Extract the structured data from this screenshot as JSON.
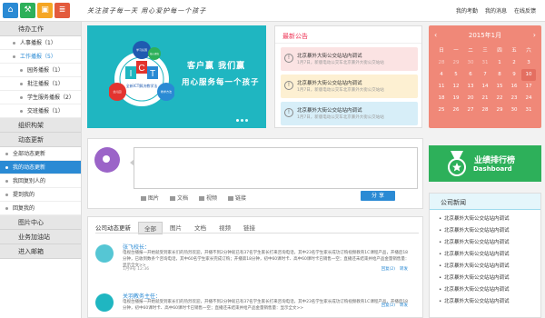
{
  "header": {
    "slogan": "关注孩子每一天   用心爱护每一个孩子",
    "links": [
      "我的考勤",
      "我的消息",
      "在线反馈"
    ],
    "icon_colors": [
      "#2a8ad4",
      "#2db05a",
      "#f5a623",
      "#e35a3c"
    ],
    "icon_names": [
      "home-icon",
      "apps-icon",
      "briefcase-icon",
      "contacts-icon"
    ]
  },
  "sidebar": {
    "sections": [
      {
        "label": "待办工作",
        "items": [
          {
            "label": "人事播报（1）",
            "level": 1
          },
          {
            "label": "工作播报（5）",
            "level": 1,
            "active": true
          },
          {
            "label": "园务播报（1）",
            "level": 2
          },
          {
            "label": "批注播报（1）",
            "level": 2
          },
          {
            "label": "学生服务播报（2）",
            "level": 2
          },
          {
            "label": "交班播报（1）",
            "level": 2
          }
        ]
      },
      {
        "label": "组织构架",
        "items": []
      },
      {
        "label": "动态更新",
        "items": [
          {
            "label": "全部动态更新",
            "level": 1
          },
          {
            "label": "我的动态更新",
            "level": 1,
            "selected": true
          },
          {
            "label": "我回复别人的",
            "level": 1
          },
          {
            "label": "提到我的",
            "level": 1
          },
          {
            "label": "回复我的",
            "level": 1
          }
        ]
      },
      {
        "label": "图片中心",
        "items": []
      },
      {
        "label": "业务加油站",
        "items": []
      },
      {
        "label": "进入邮箱",
        "items": []
      }
    ]
  },
  "banner": {
    "line1": "客户赢   我们赢",
    "line2": "用心服务每一个孩子",
    "logo_letters": [
      "I",
      "C",
      "T"
    ],
    "logo_caption": "全新ICT解决教学法",
    "bubbles": [
      "学习氛围",
      "幼儿园",
      "教学方法",
      "核心理念"
    ]
  },
  "notices": {
    "title": "最新公告",
    "items": [
      {
        "title": "北京暴外大街公交站站内调试",
        "detail": "1月7日，新版电动公交车北京暴外大街公交站站",
        "color": "#fbe3e3"
      },
      {
        "title": "北京暴外大街公交站站内调试",
        "detail": "1月7日，新版电动公交车北京暴外大街公交站站",
        "color": "#fdf0d2"
      },
      {
        "title": "北京暴外大街公交站站内调试",
        "detail": "1月7日，新版电动公交车北京暴外大街公交站站",
        "color": "#d7eef8"
      }
    ]
  },
  "calendar": {
    "title": "2015年1月",
    "weekdays": [
      "日",
      "一",
      "二",
      "三",
      "四",
      "五",
      "六"
    ],
    "days": [
      "28",
      "29",
      "30",
      "31",
      "1",
      "2",
      "3",
      "4",
      "5",
      "6",
      "7",
      "8",
      "9",
      "10",
      "11",
      "12",
      "13",
      "14",
      "15",
      "16",
      "17",
      "18",
      "19",
      "20",
      "21",
      "22",
      "23",
      "24",
      "25",
      "26",
      "27",
      "28",
      "29",
      "30",
      "31"
    ],
    "today": "10"
  },
  "post": {
    "tools": [
      "图片",
      "文档",
      "视频",
      "链接"
    ],
    "share": "分 享"
  },
  "ranking": {
    "title": "业绩排行榜",
    "subtitle": "Dashboard"
  },
  "news": {
    "title": "公司新闻",
    "items": [
      "北京暴外大街公交站站内调试",
      "北京暴外大街公交站站内调试",
      "北京暴外大街公交站站内调试",
      "北京暴外大街公交站站内调试",
      "北京暴外大街公交站站内调试",
      "北京暴外大街公交站站内调试",
      "北京暴外大街公交站站内调试",
      "北京暴外大街公交站站内调试"
    ]
  },
  "feed": {
    "tabs": [
      "公司动态更新",
      "全部",
      "图片",
      "文档",
      "视频",
      "链接"
    ],
    "entries": [
      {
        "name": "张飞校长：",
        "text": "电视台播报一开始就受到家长们的热烈欢迎，开播不到2分钟就已有37名学生家长打来咨询电话，其中23名学生家长成功订购视频教育1C课程产品，开播后18分钟，已收到数条个咨询电话，其中60名学生家长完成订购；开播第18分钟，初中60课时卡、高中60课时卡已销售一空；直播还未结束并给产品金量销售量：显示全文>>",
        "meta": "1月9号  12:36",
        "acts": [
          "回复(2)",
          "转发"
        ]
      },
      {
        "name": "关羽教务主任：",
        "text": "电视台播报一开始就受到家长们的热烈欢迎，开播不到2分钟就已有37名学生家长打来咨询电话，其中23名学生家长成功订购视频教育1C课程产品，开播后18分钟，初中60课时卡、高中60课时卡已销售一空；直播还未结束并给产品金量销售量：显示全文>>",
        "meta": "",
        "acts": [
          "回复(2)",
          "转发"
        ]
      }
    ]
  }
}
